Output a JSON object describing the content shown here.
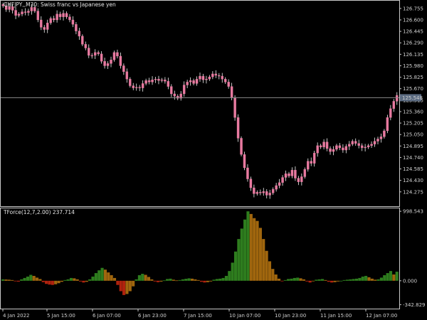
{
  "window": {
    "symbol_title": "CHFJPY,,M30:  Swiss franc vs Japanese yen",
    "indicator_title": "TForce(12,7,2.00) 237.714"
  },
  "colors": {
    "background": "#000000",
    "frame": "#c8c8c8",
    "candle": "#e87aa0",
    "candle_wick": "#f2f2f2",
    "bid_line": "#8a8a8a",
    "bid_label_bg": "#5a6a80",
    "hist_up_strong": "#2e7d1e",
    "hist_up_weak": "#a0660e",
    "hist_down_strong": "#b0220e",
    "hist_down_weak": "#a0660e"
  },
  "chart_data": [
    {
      "type": "line",
      "name_in_ui": "main",
      "ylim": [
        124.1,
        126.85
      ],
      "y_ticks": [
        "126.755",
        "126.600",
        "126.445",
        "126.290",
        "126.135",
        "125.980",
        "125.825",
        "125.670",
        "125.515",
        "125.360",
        "125.205",
        "125.050",
        "124.895",
        "124.740",
        "124.585",
        "124.430",
        "124.275"
      ],
      "bid_label": "125.548",
      "bid_value": 125.548,
      "x_ticks": [
        "4 Jan 2022",
        "5 Jan 15:00",
        "6 Jan 07:00",
        "6 Jan 23:00",
        "7 Jan 15:00",
        "10 Jan 07:00",
        "10 Jan 23:00",
        "11 Jan 15:00",
        "12 Jan 07:00"
      ],
      "close": [
        126.79,
        126.74,
        126.78,
        126.73,
        126.66,
        126.68,
        126.71,
        126.7,
        126.72,
        126.77,
        126.72,
        126.6,
        126.5,
        126.47,
        126.56,
        126.62,
        126.6,
        126.68,
        126.64,
        126.69,
        126.64,
        126.6,
        126.54,
        126.45,
        126.38,
        126.27,
        126.22,
        126.12,
        126.12,
        126.16,
        126.14,
        126.04,
        125.98,
        126.01,
        126.06,
        126.16,
        126.11,
        125.98,
        125.9,
        125.8,
        125.71,
        125.68,
        125.69,
        125.68,
        125.74,
        125.78,
        125.76,
        125.79,
        125.8,
        125.78,
        125.79,
        125.77,
        125.7,
        125.6,
        125.57,
        125.54,
        125.6,
        125.72,
        125.76,
        125.78,
        125.74,
        125.8,
        125.84,
        125.79,
        125.8,
        125.83,
        125.87,
        125.85,
        125.84,
        125.8,
        125.76,
        125.7,
        125.55,
        125.28,
        125.0,
        124.78,
        124.6,
        124.45,
        124.33,
        124.25,
        124.27,
        124.26,
        124.28,
        124.23,
        124.26,
        124.31,
        124.36,
        124.4,
        124.47,
        124.52,
        124.49,
        124.57,
        124.46,
        124.41,
        124.48,
        124.58,
        124.69,
        124.66,
        124.8,
        124.9,
        124.88,
        124.95,
        124.86,
        124.82,
        124.85,
        124.9,
        124.87,
        124.84,
        124.89,
        124.92,
        124.96,
        124.93,
        124.9,
        124.87,
        124.88,
        124.9,
        124.92,
        124.96,
        124.99,
        125.02,
        125.1,
        125.28,
        125.4,
        125.5,
        125.58
      ]
    },
    {
      "type": "bar",
      "name_in_ui": "indicator",
      "ylim": [
        -380,
        1010
      ],
      "y_ticks": [
        "998.543",
        "0.000",
        "-342.829"
      ],
      "values": [
        20,
        18,
        15,
        10,
        -8,
        -12,
        20,
        40,
        60,
        85,
        70,
        45,
        25,
        -20,
        -45,
        -55,
        -60,
        -50,
        -35,
        -15,
        10,
        20,
        40,
        35,
        20,
        -10,
        -25,
        -15,
        20,
        60,
        110,
        150,
        185,
        160,
        120,
        80,
        40,
        -60,
        -150,
        -205,
        -190,
        -150,
        -80,
        20,
        80,
        100,
        85,
        55,
        20,
        -10,
        -20,
        -12,
        5,
        25,
        30,
        15,
        5,
        10,
        20,
        28,
        35,
        30,
        20,
        10,
        -15,
        -25,
        -20,
        -10,
        15,
        25,
        30,
        40,
        70,
        140,
        260,
        420,
        600,
        750,
        880,
        998,
        960,
        900,
        860,
        760,
        600,
        430,
        280,
        170,
        90,
        30,
        -5,
        10,
        25,
        30,
        40,
        45,
        35,
        20,
        -10,
        -25,
        -5,
        15,
        20,
        25,
        10,
        -15,
        -25,
        -20,
        -10,
        0,
        10,
        15,
        20,
        25,
        30,
        40,
        60,
        70,
        50,
        30,
        15,
        20,
        45,
        80,
        110,
        140,
        90,
        130
      ]
    }
  ]
}
